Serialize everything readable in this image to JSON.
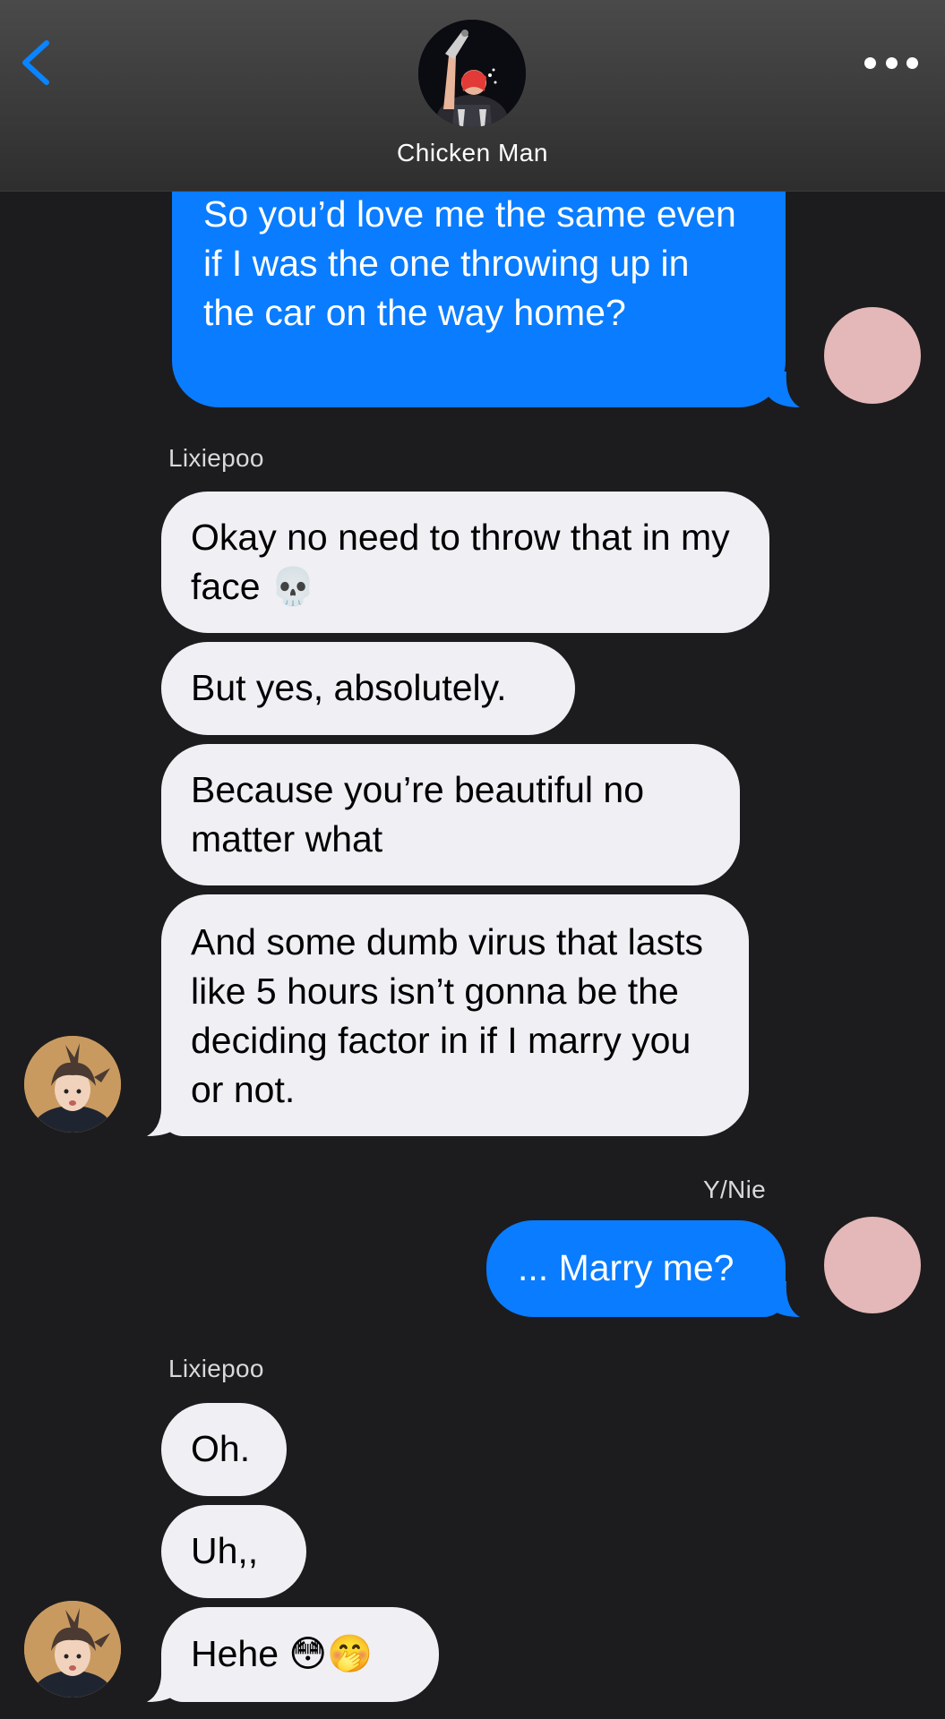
{
  "header": {
    "contact_name": "Chicken Man"
  },
  "messages": [
    {
      "id": "m1",
      "direction": "outgoing",
      "text": "So you’d love me the same even if I was the one throwing up in the car on the way home?"
    },
    {
      "id": "m2",
      "direction": "incoming",
      "sender": "Lixiepoo",
      "text": "Okay no need to throw that in my face 💀"
    },
    {
      "id": "m3",
      "direction": "incoming",
      "text": "But yes, absolutely."
    },
    {
      "id": "m4",
      "direction": "incoming",
      "text": "Because you’re beautiful no matter what"
    },
    {
      "id": "m5",
      "direction": "incoming",
      "text": "And some dumb virus that lasts like 5 hours isn’t gonna be the deciding factor in if I marry you or not."
    },
    {
      "id": "m6",
      "direction": "outgoing",
      "sender": "Y/Nie",
      "text": "... Marry me?"
    },
    {
      "id": "m7",
      "direction": "incoming",
      "sender": "Lixiepoo",
      "text": "Oh."
    },
    {
      "id": "m8",
      "direction": "incoming",
      "text": "Uh,,"
    },
    {
      "id": "m9",
      "direction": "incoming",
      "text": "Hehe 😳🤭"
    }
  ],
  "colors": {
    "outgoing_bubble": "#0a7cff",
    "incoming_bubble": "#efeff4",
    "background": "#1c1c1e",
    "accent": "#0a84ff"
  },
  "icons": {
    "back": "chevron-left-icon",
    "more": "ellipsis-icon"
  }
}
